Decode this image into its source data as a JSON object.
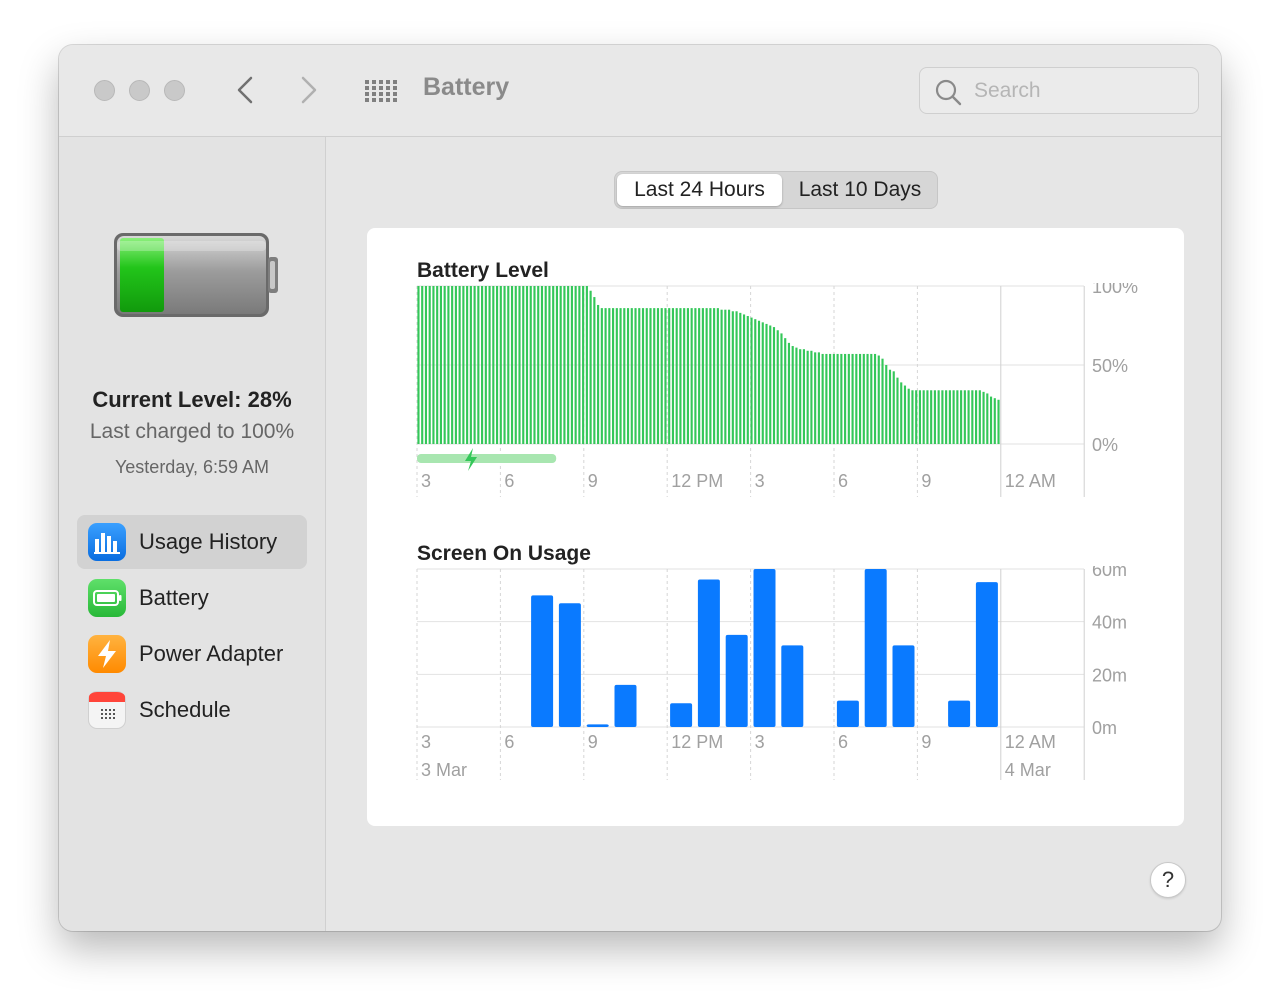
{
  "window": {
    "title": "Battery"
  },
  "toolbar": {
    "search_placeholder": "Search"
  },
  "status": {
    "current_level": "Current Level: 28%",
    "last_charged": "Last charged to 100%",
    "charged_time": "Yesterday, 6:59 AM"
  },
  "sidebar": {
    "items": [
      {
        "label": "Usage History",
        "active": true
      },
      {
        "label": "Battery",
        "active": false
      },
      {
        "label": "Power Adapter",
        "active": false
      },
      {
        "label": "Schedule",
        "active": false
      }
    ]
  },
  "range": {
    "options": [
      "Last 24 Hours",
      "Last 10 Days"
    ],
    "selected": "Last 24 Hours"
  },
  "colors": {
    "battery_green": "#34c759",
    "usage_blue": "#0a7aff",
    "charging_band": "#a8e6b0"
  },
  "chart_data": [
    {
      "type": "bar",
      "title": "Battery Level",
      "ylim": [
        0,
        100
      ],
      "y_tick_labels": [
        "100%",
        "50%",
        "0%"
      ],
      "x_tick_labels": [
        "3",
        "6",
        "9",
        "12 PM",
        "3",
        "6",
        "9",
        "12 AM"
      ],
      "unit": "%",
      "values": [
        100,
        100,
        100,
        100,
        100,
        100,
        100,
        100,
        100,
        100,
        100,
        100,
        100,
        100,
        100,
        100,
        100,
        100,
        100,
        100,
        100,
        100,
        100,
        100,
        100,
        100,
        100,
        100,
        100,
        100,
        100,
        100,
        100,
        100,
        100,
        100,
        100,
        100,
        100,
        100,
        100,
        100,
        100,
        100,
        100,
        100,
        97,
        93,
        88,
        86,
        86,
        86,
        86,
        86,
        86,
        86,
        86,
        86,
        86,
        86,
        86,
        86,
        86,
        86,
        86,
        86,
        86,
        86,
        86,
        86,
        86,
        86,
        86,
        86,
        86,
        86,
        86,
        86,
        86,
        86,
        86,
        85,
        85,
        85,
        84,
        84,
        83,
        82,
        81,
        80,
        79,
        78,
        77,
        76,
        75,
        74,
        72,
        70,
        67,
        64,
        62,
        61,
        60,
        60,
        59,
        59,
        58,
        58,
        57,
        57,
        57,
        57,
        57,
        57,
        57,
        57,
        57,
        57,
        57,
        57,
        57,
        57,
        57,
        56,
        54,
        50,
        47,
        46,
        42,
        39,
        37,
        35,
        34,
        34,
        34,
        34,
        34,
        34,
        34,
        34,
        34,
        34,
        34,
        34,
        34,
        34,
        34,
        34,
        34,
        34,
        34,
        33,
        32,
        30,
        29,
        28
      ],
      "charging_span": {
        "from_hour": 2,
        "to_hour": 6
      }
    },
    {
      "type": "bar",
      "title": "Screen On Usage",
      "ylim": [
        0,
        60
      ],
      "y_tick_labels": [
        "60m",
        "40m",
        "20m",
        "0m"
      ],
      "x_tick_labels": [
        "3",
        "6",
        "9",
        "12 PM",
        "3",
        "6",
        "9",
        "12 AM"
      ],
      "date_labels": [
        "3 Mar",
        "4 Mar"
      ],
      "unit": "minutes",
      "values": [
        0,
        0,
        0,
        0,
        50,
        47,
        1,
        16,
        0,
        9,
        56,
        35,
        60,
        31,
        0,
        10,
        60,
        31,
        0,
        10,
        55
      ]
    }
  ]
}
